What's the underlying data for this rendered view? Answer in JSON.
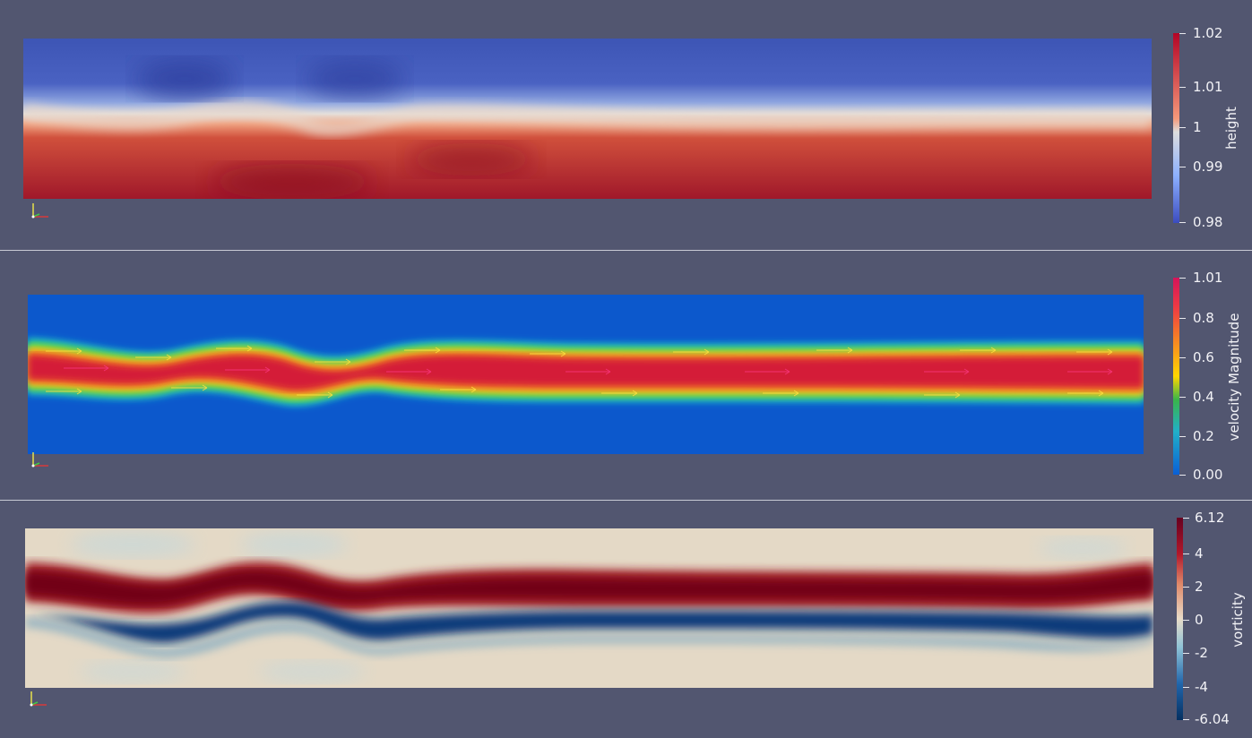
{
  "panels": [
    {
      "field": "height",
      "colorbar": {
        "title": "height",
        "ticks": [
          "1.02",
          "1.01",
          "1",
          "0.99",
          "0.98"
        ],
        "colors": [
          "#b40426",
          "#f4987a",
          "#dddddd",
          "#8db0fe",
          "#3b4cc0"
        ]
      },
      "axes_icon": "orientation-axes-icon"
    },
    {
      "field": "velocity Magnitude",
      "colorbar": {
        "title": "velocity Magnitude",
        "ticks": [
          "1.01",
          "0.8",
          "0.6",
          "0.4",
          "0.2",
          "0.00"
        ],
        "colors": [
          "#d4145a",
          "#f7931e",
          "#ffd700",
          "#39b54a",
          "#1fa0e0",
          "#0a5fd6"
        ]
      },
      "axes_icon": "orientation-axes-icon",
      "glyphs_icon": "arrow-glyphs-icon"
    },
    {
      "field": "vorticity",
      "colorbar": {
        "title": "vorticity",
        "ticks": [
          "6.12",
          "4",
          "2",
          "0",
          "-2",
          "-4",
          "-6.04"
        ],
        "colors": [
          "#67001f",
          "#b2182b",
          "#e08a6a",
          "#e8dcc8",
          "#8fc3d6",
          "#2166ac",
          "#053061"
        ]
      },
      "axes_icon": "orientation-axes-icon"
    }
  ]
}
